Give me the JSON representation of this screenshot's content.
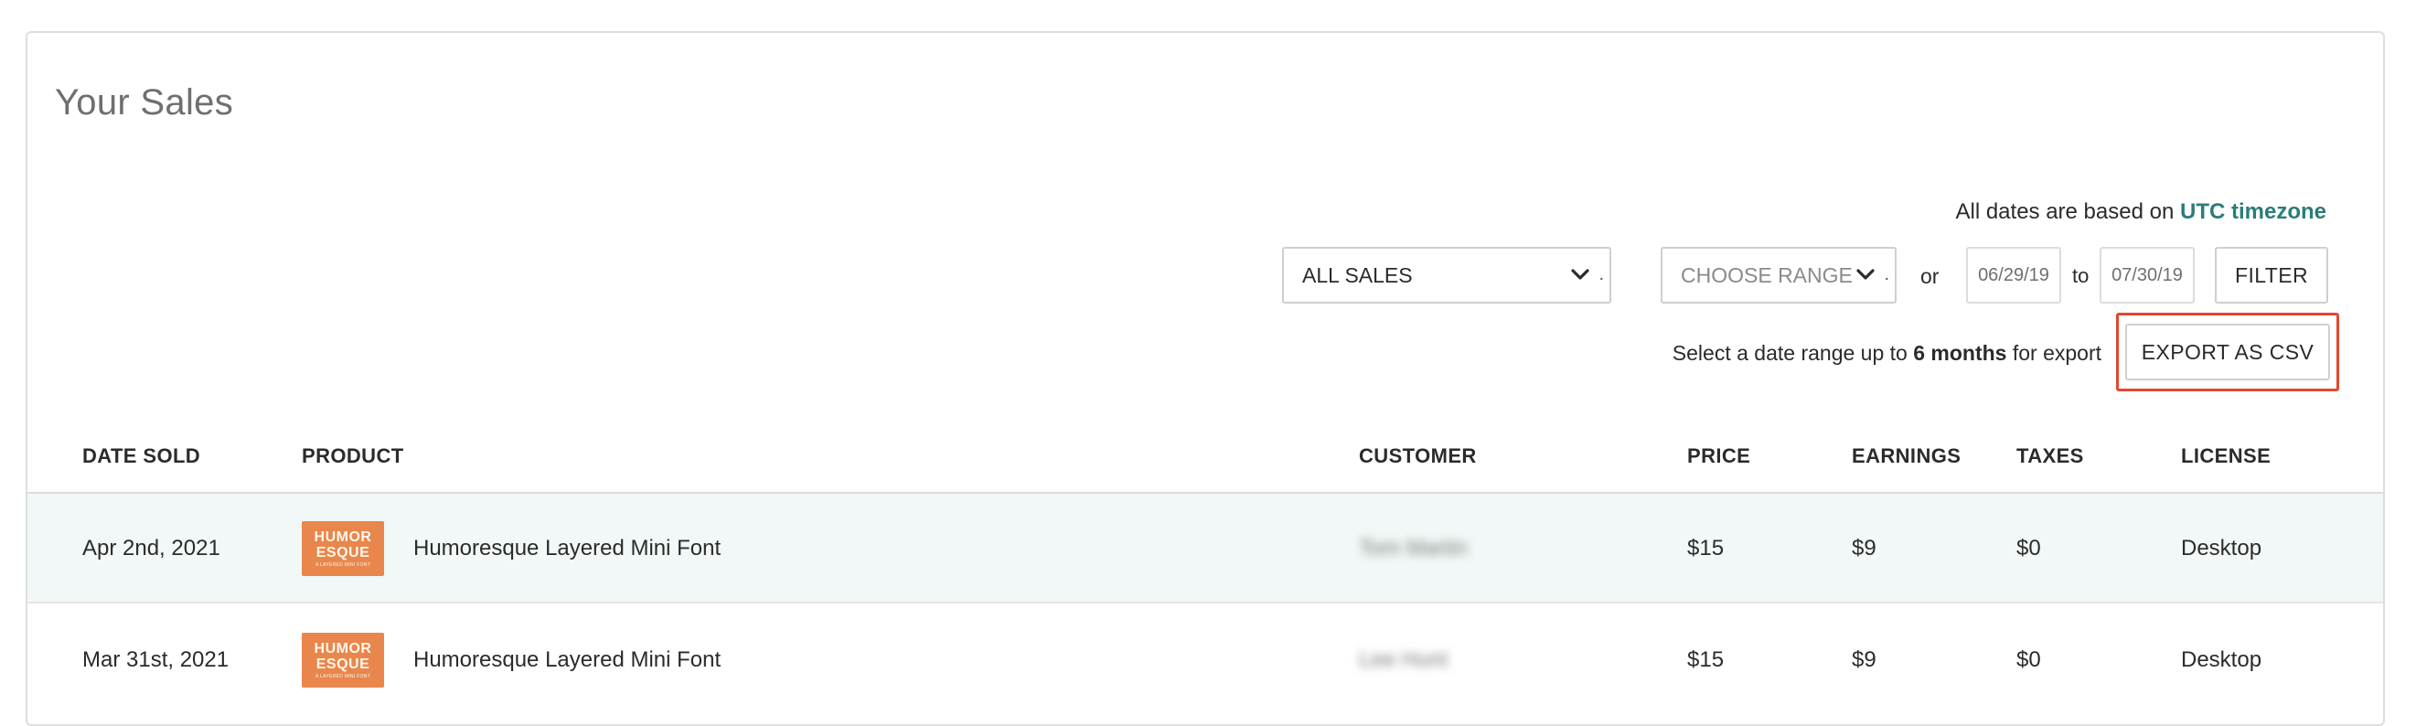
{
  "page": {
    "title": "Your Sales"
  },
  "timezone_note": {
    "prefix": "All dates are based on",
    "link": "UTC timezone"
  },
  "filters": {
    "sales_select": {
      "value": "ALL SALES",
      "icon": "chevron-down-icon"
    },
    "range_select": {
      "value": "CHOOSE RANGE",
      "icon": "chevron-down-icon"
    },
    "or_label": "or",
    "date_from": "06/29/19",
    "to_label": "to",
    "date_to": "07/30/19",
    "filter_button": "FILTER"
  },
  "export": {
    "note_prefix": "Select a date range up to",
    "note_bold": "6 months",
    "note_suffix": "for export",
    "button": "EXPORT AS CSV",
    "highlight_color": "#e2472f"
  },
  "table": {
    "columns": {
      "date_sold": "DATE SOLD",
      "product": "PRODUCT",
      "customer": "CUSTOMER",
      "price": "PRICE",
      "earnings": "EARNINGS",
      "taxes": "TAXES",
      "license": "LICENSE"
    },
    "rows": [
      {
        "date_sold": "Apr 2nd, 2021",
        "thumb_line1": "HUMOR",
        "thumb_line2": "ESQUE",
        "thumb_caption": "A LAYERED MINI FONT",
        "product": "Humoresque Layered Mini Font",
        "customer": "Tom Martin",
        "price": "$15",
        "earnings": "$9",
        "taxes": "$0",
        "license": "Desktop"
      },
      {
        "date_sold": "Mar 31st, 2021",
        "thumb_line1": "HUMOR",
        "thumb_line2": "ESQUE",
        "thumb_caption": "A LAYERED MINI FONT",
        "product": "Humoresque Layered Mini Font",
        "customer": "Lee Hunt",
        "price": "$15",
        "earnings": "$9",
        "taxes": "$0",
        "license": "Desktop"
      }
    ]
  },
  "colors": {
    "accent": "#2a7d78",
    "row_highlight": "#f2f8f7",
    "thumb_bg": "#e9864c"
  }
}
